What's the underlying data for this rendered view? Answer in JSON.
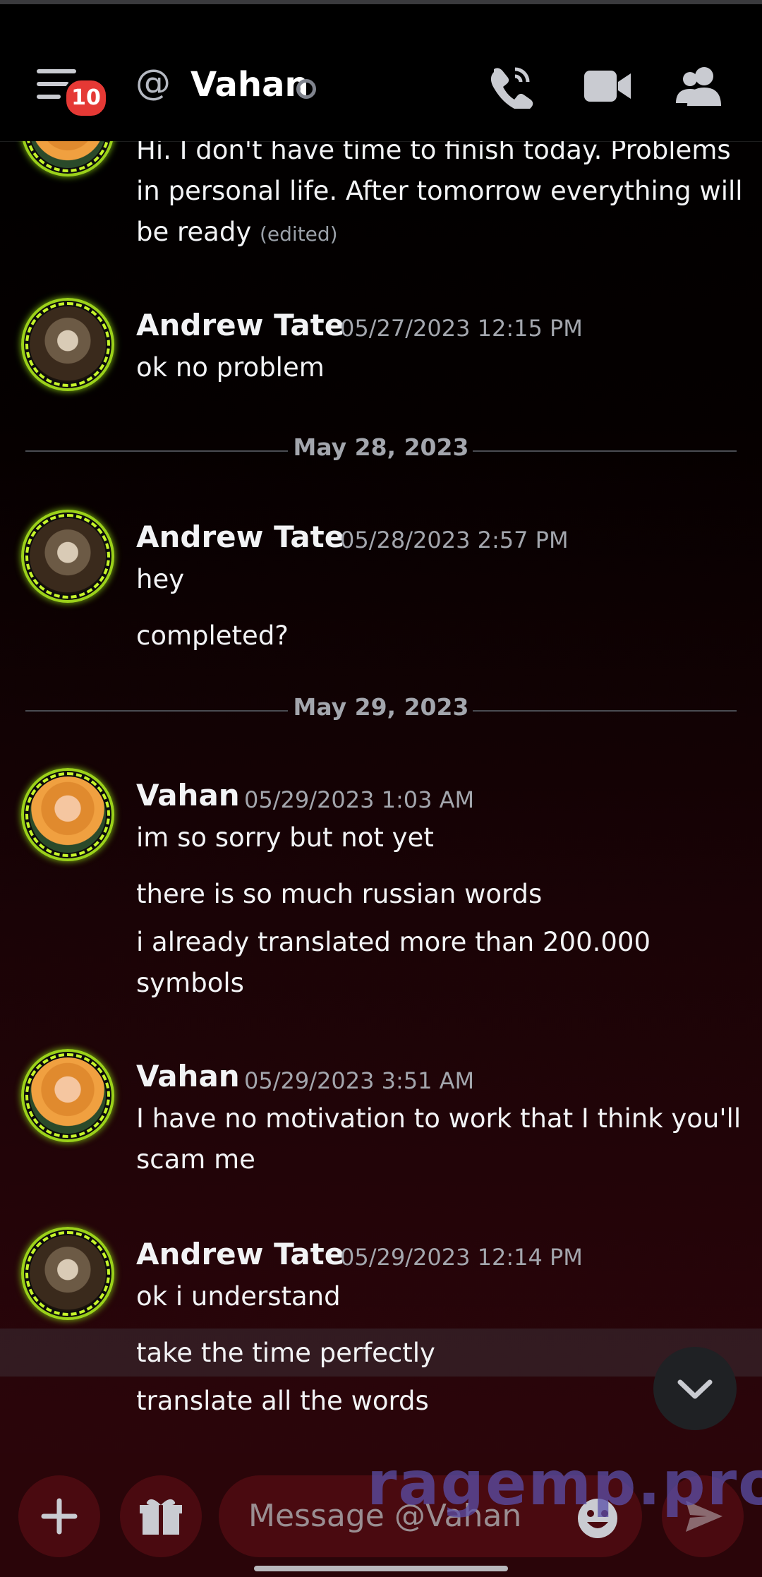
{
  "header": {
    "notification_count": "10",
    "at_symbol": "@",
    "title": "Vahan"
  },
  "messages": {
    "partial_text": "Hi. I don't have time to finish today. Problems in personal life. After tomorrow everything will be ready",
    "partial_edited": "(edited)",
    "g1": {
      "author": "Andrew Tate",
      "time": "05/27/2023 12:15 PM",
      "lines": [
        "ok no problem"
      ]
    },
    "divider1": "May 28, 2023",
    "g2": {
      "author": "Andrew Tate",
      "time": "05/28/2023 2:57 PM",
      "lines": [
        "hey",
        "completed?"
      ]
    },
    "divider2": "May 29, 2023",
    "g3": {
      "author": "Vahan",
      "time": "05/29/2023 1:03 AM",
      "lines": [
        "im so sorry but not yet",
        "there is so much russian words",
        "i already translated more than 200.000 symbols"
      ]
    },
    "g4": {
      "author": "Vahan",
      "time": "05/29/2023 3:51 AM",
      "lines": [
        "I have no motivation to work that I think you'll scam me"
      ]
    },
    "g5": {
      "author": "Andrew Tate",
      "time": "05/29/2023 12:14 PM",
      "lines": [
        "ok i understand",
        "take the time perfectly",
        "translate all the words"
      ]
    }
  },
  "composer": {
    "placeholder": "Message @Vahan"
  },
  "watermark": "ragemp.pro",
  "colors": {
    "badge_red": "#e53935",
    "avatar_ring": "#9bd11a",
    "bottom_bar": "#2a0509"
  }
}
